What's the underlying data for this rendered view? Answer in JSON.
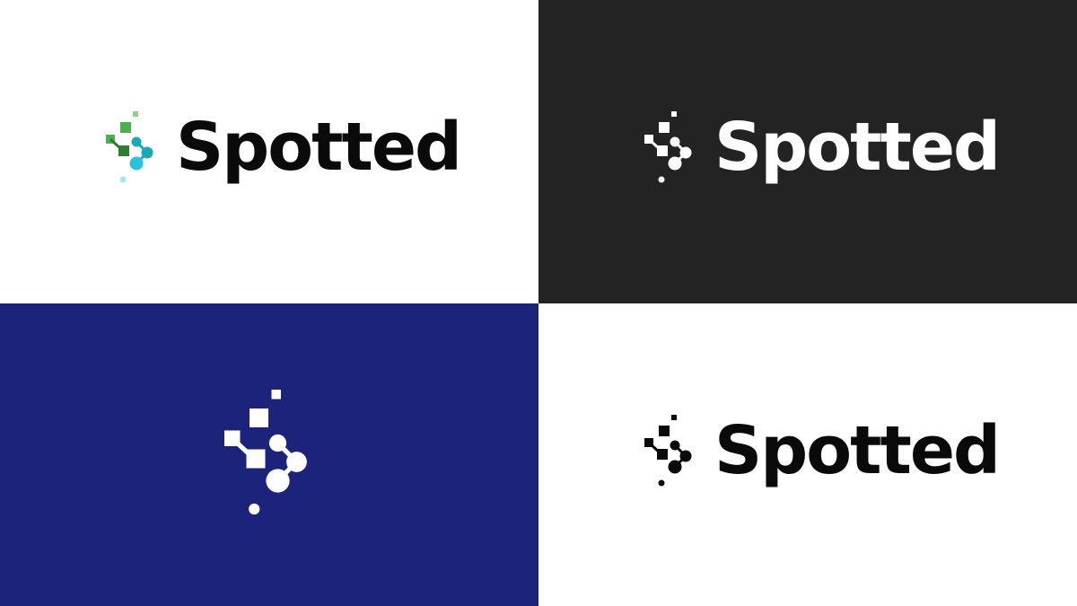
{
  "brand": {
    "name": "Spotted"
  },
  "panels": [
    {
      "id": "light-full-color",
      "background": "#ffffff",
      "mark_style": "full-color",
      "text_color": "#0a0a0a"
    },
    {
      "id": "dark",
      "background": "#232323",
      "mark_style": "white",
      "text_color": "#ffffff"
    },
    {
      "id": "navy-icon-only",
      "background": "#1b237b",
      "mark_style": "white",
      "text_color": ""
    },
    {
      "id": "light-mono",
      "background": "#ffffff",
      "mark_style": "black",
      "text_color": "#0a0a0a"
    }
  ],
  "colors": {
    "green_light": "#8fd28c",
    "green": "#4caf50",
    "green_dark": "#2e7d32",
    "teal": "#1ba9b8",
    "cyan": "#29c2e0",
    "cyan_light": "#a8e4ef",
    "white": "#ffffff",
    "black": "#0a0a0a"
  },
  "icons": {
    "mark": "spotted-logomark-icon"
  }
}
